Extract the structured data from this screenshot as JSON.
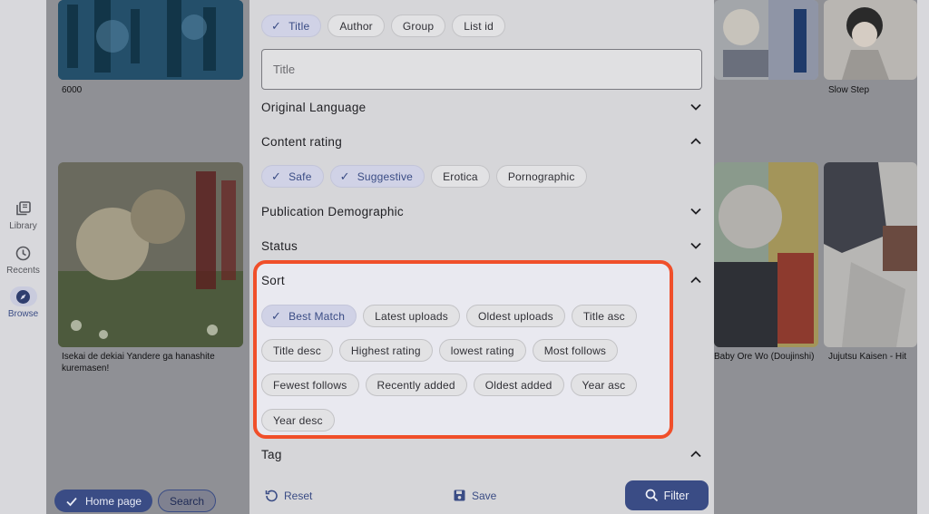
{
  "nav": {
    "items": [
      {
        "label": "Library",
        "icon": "library-icon"
      },
      {
        "label": "Recents",
        "icon": "clock-icon"
      },
      {
        "label": "Browse",
        "icon": "compass-icon"
      }
    ]
  },
  "covers": {
    "titles": [
      "6000",
      "Slow Step",
      "Isekai de dekiai Yandere ga hanashite kuremasen!",
      "Baby Ore Wo (Doujinshi)",
      "Jujutsu Kaisen - Hit"
    ]
  },
  "bottom": {
    "home_label": "Home page",
    "search_label": "Search"
  },
  "filter": {
    "search_by": [
      "Title",
      "Author",
      "Group",
      "List id"
    ],
    "search_by_selected": "Title",
    "title_placeholder": "Title",
    "sections": {
      "original_language": "Original Language",
      "content_rating": "Content rating",
      "publication_demographic": "Publication Demographic",
      "status": "Status",
      "sort": "Sort",
      "tag": "Tag"
    },
    "content_ratings": [
      "Safe",
      "Suggestive",
      "Erotica",
      "Pornographic"
    ],
    "content_ratings_selected": [
      "Safe",
      "Suggestive"
    ],
    "sort_options": [
      "Best Match",
      "Latest uploads",
      "Oldest uploads",
      "Title asc",
      "Title desc",
      "Highest rating",
      "lowest rating",
      "Most follows",
      "Fewest follows",
      "Recently added",
      "Oldest added",
      "Year asc",
      "Year desc"
    ],
    "sort_selected": "Best Match",
    "actions": {
      "reset": "Reset",
      "save": "Save",
      "filter": "Filter"
    }
  },
  "colors": {
    "accent": "#3a4c85",
    "highlight": "#f04f2a"
  }
}
